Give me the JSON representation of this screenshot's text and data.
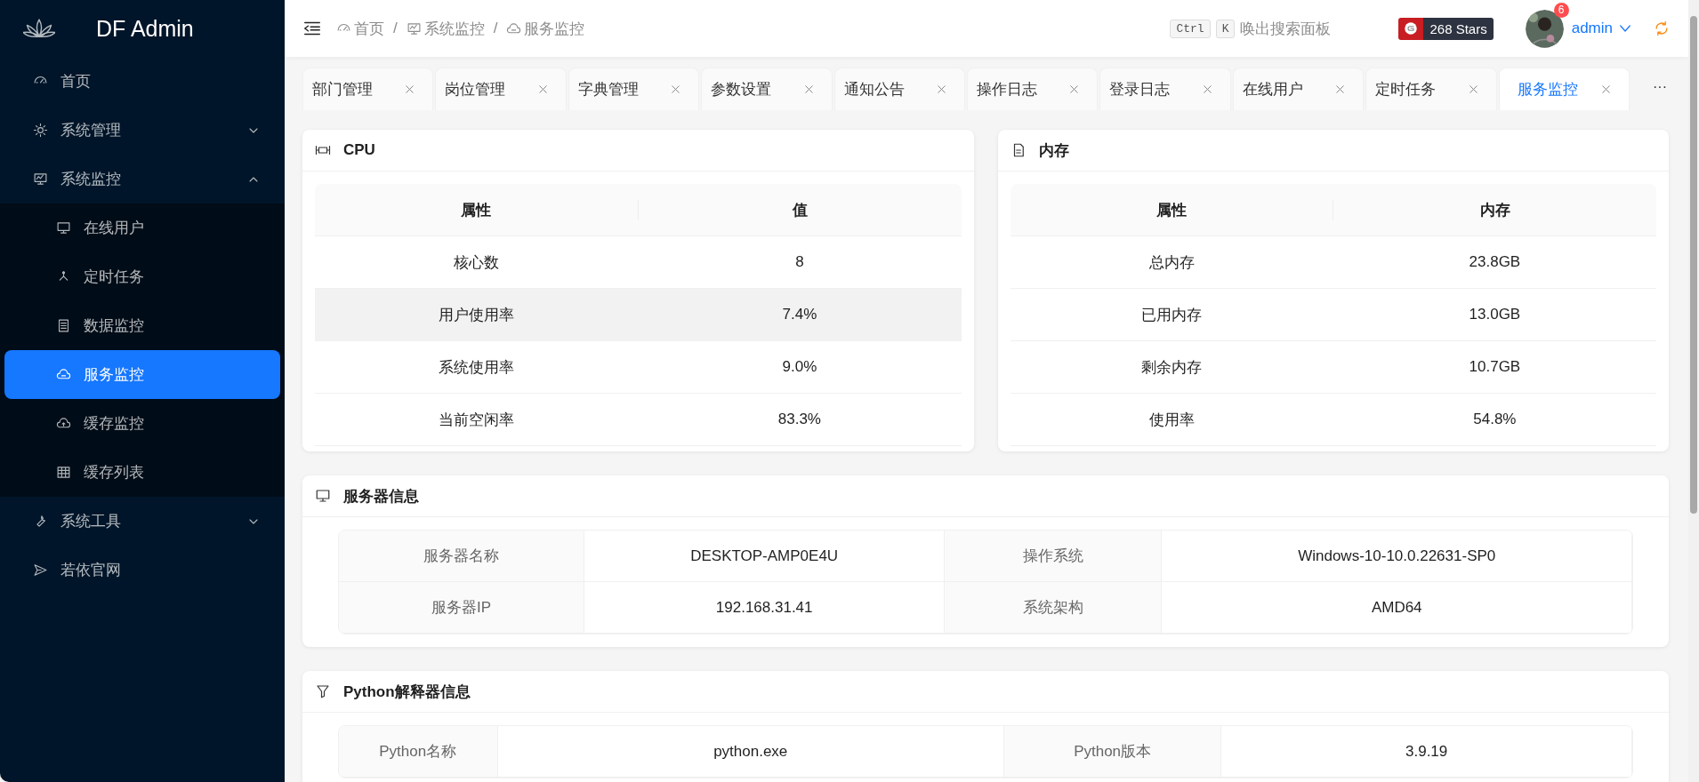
{
  "logo": {
    "text": "DF Admin"
  },
  "sidebar": {
    "items": [
      {
        "kind": "link",
        "label": "首页",
        "selected": false
      },
      {
        "kind": "group",
        "label": "系统管理",
        "expanded": false
      },
      {
        "kind": "group",
        "label": "系统监控",
        "expanded": true,
        "children": [
          {
            "label": "在线用户",
            "selected": false
          },
          {
            "label": "定时任务",
            "selected": false
          },
          {
            "label": "数据监控",
            "selected": false
          },
          {
            "label": "服务监控",
            "selected": true
          },
          {
            "label": "缓存监控",
            "selected": false
          },
          {
            "label": "缓存列表",
            "selected": false
          }
        ]
      },
      {
        "kind": "group",
        "label": "系统工具",
        "expanded": false
      },
      {
        "kind": "link",
        "label": "若依官网",
        "selected": false
      }
    ]
  },
  "header": {
    "breadcrumb": [
      {
        "label": "首页"
      },
      {
        "label": "系统监控"
      },
      {
        "label": "服务监控"
      }
    ],
    "separator": "/",
    "search_hint": {
      "keys": [
        "Ctrl",
        "K"
      ],
      "text": "唤出搜索面板"
    },
    "stars": "268 Stars",
    "notification_count": "6",
    "user": "admin"
  },
  "tabs": {
    "items": [
      {
        "label": "部门管理",
        "selected": false
      },
      {
        "label": "岗位管理",
        "selected": false
      },
      {
        "label": "字典管理",
        "selected": false
      },
      {
        "label": "参数设置",
        "selected": false
      },
      {
        "label": "通知公告",
        "selected": false
      },
      {
        "label": "操作日志",
        "selected": false
      },
      {
        "label": "登录日志",
        "selected": false
      },
      {
        "label": "在线用户",
        "selected": false
      },
      {
        "label": "定时任务",
        "selected": false
      },
      {
        "label": "服务监控",
        "selected": true
      }
    ],
    "more": "···"
  },
  "cpu": {
    "title": "CPU",
    "columns": [
      "属性",
      "值"
    ],
    "rows": [
      {
        "cells": [
          "核心数",
          "8"
        ],
        "highlighted": false
      },
      {
        "cells": [
          "用户使用率",
          "7.4%"
        ],
        "highlighted": true
      },
      {
        "cells": [
          "系统使用率",
          "9.0%"
        ],
        "highlighted": false
      },
      {
        "cells": [
          "当前空闲率",
          "83.3%"
        ],
        "highlighted": false
      }
    ]
  },
  "memory": {
    "title": "内存",
    "columns": [
      "属性",
      "内存"
    ],
    "rows": [
      {
        "cells": [
          "总内存",
          "23.8GB"
        ],
        "highlighted": false
      },
      {
        "cells": [
          "已用内存",
          "13.0GB"
        ],
        "highlighted": false
      },
      {
        "cells": [
          "剩余内存",
          "10.7GB"
        ],
        "highlighted": false
      },
      {
        "cells": [
          "使用率",
          "54.8%"
        ],
        "highlighted": false
      }
    ]
  },
  "server": {
    "title": "服务器信息",
    "rows": [
      [
        "服务器名称",
        "DESKTOP-AMP0E4U",
        "操作系统",
        "Windows-10-10.0.22631-SP0"
      ],
      [
        "服务器IP",
        "192.168.31.41",
        "系统架构",
        "AMD64"
      ]
    ]
  },
  "python": {
    "title": "Python解释器信息",
    "rows": [
      [
        "Python名称",
        "python.exe",
        "Python版本",
        "3.9.19"
      ]
    ]
  }
}
